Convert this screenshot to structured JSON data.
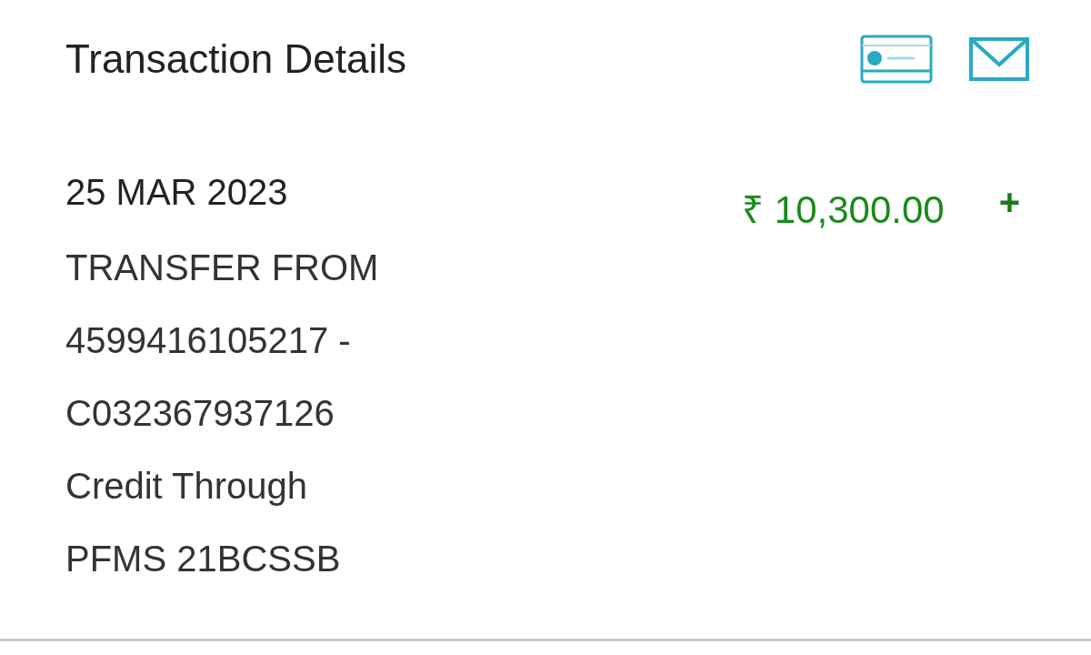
{
  "header": {
    "title": "Transaction Details"
  },
  "transaction": {
    "date": "25 MAR 2023",
    "description_lines": [
      "TRANSFER FROM",
      "4599416105217 -",
      "C032367937126",
      "Credit Through",
      "PFMS 21BCSSB"
    ],
    "amount": "₹ 10,300.00",
    "sign": "+"
  }
}
